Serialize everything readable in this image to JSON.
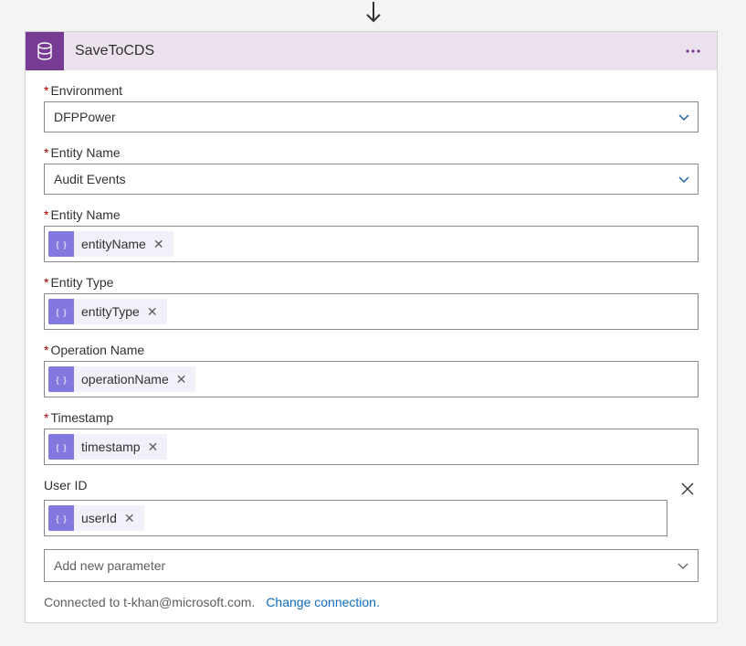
{
  "header": {
    "title": "SaveToCDS"
  },
  "fields": {
    "environment": {
      "label": "Environment",
      "value": "DFPPower"
    },
    "entityNameSelect": {
      "label": "Entity Name",
      "value": "Audit Events"
    },
    "entityNameToken": {
      "label": "Entity Name",
      "token": "entityName"
    },
    "entityType": {
      "label": "Entity Type",
      "token": "entityType"
    },
    "operationName": {
      "label": "Operation Name",
      "token": "operationName"
    },
    "timestamp": {
      "label": "Timestamp",
      "token": "timestamp"
    },
    "userId": {
      "label": "User ID",
      "token": "userId"
    }
  },
  "addParam": {
    "placeholder": "Add new parameter"
  },
  "footer": {
    "connected": "Connected to t-khan@microsoft.com.",
    "changeLink": "Change connection."
  }
}
